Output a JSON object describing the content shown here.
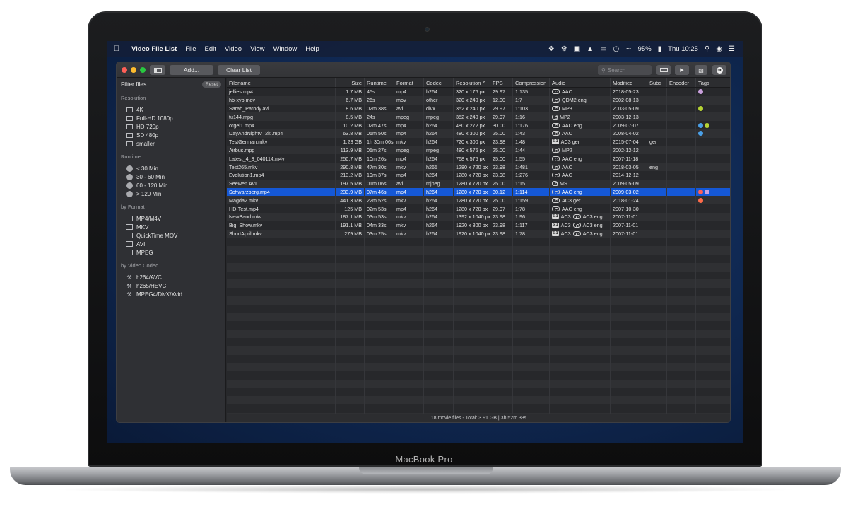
{
  "device": {
    "label": "MacBook Pro"
  },
  "menubar": {
    "app_name": "Video File List",
    "items": [
      "File",
      "Edit",
      "Video",
      "View",
      "Window",
      "Help"
    ],
    "battery": "95%",
    "clock": "Thu 10:25"
  },
  "toolbar": {
    "add_label": "Add...",
    "clear_label": "Clear List",
    "search_placeholder": "Search"
  },
  "sidebar": {
    "filter_title": "Filter files...",
    "reset_label": "Reset",
    "sections": [
      {
        "title": "Resolution",
        "icon": "film-icon",
        "items": [
          "4K",
          "Full-HD 1080p",
          "HD 720p",
          "SD 480p",
          "smaller"
        ]
      },
      {
        "title": "Runtime",
        "icon": "clock-icon",
        "items": [
          "< 30 Min",
          "30 - 60 Min",
          "60 - 120 Min",
          "> 120 Min"
        ]
      },
      {
        "title": "by Format",
        "icon": "format-icon",
        "items": [
          "MP4/M4V",
          "MKV",
          "QuickTime MOV",
          "AVI",
          "MPEG"
        ]
      },
      {
        "title": "by Video Codec",
        "icon": "wrench-icon",
        "items": [
          "h264/AVC",
          "h265/HEVC",
          "MPEG4/DivX/Xvid"
        ]
      }
    ]
  },
  "table": {
    "columns": [
      "Filename",
      "Size",
      "Runtime",
      "Format",
      "Codec",
      "Resolution",
      "FPS",
      "Compression",
      "Audio",
      "Modified",
      "Subs",
      "Encoder",
      "Tags"
    ],
    "sort_indicator": "^",
    "selected_index": 12,
    "rows": [
      {
        "file": "jellies.mp4",
        "size": "1.7 MB",
        "run": "45s",
        "fmt": "mp4",
        "codec": "h264",
        "res": "320 x 176 px",
        "fps": "29.97",
        "comp": "1:135",
        "audio": [
          {
            "k": "stereo",
            "t": "AAC"
          }
        ],
        "mod": "2018-05-23",
        "subs": "",
        "enc": "",
        "tags": [
          "#c9a0dc"
        ]
      },
      {
        "file": "hb-xyb.mov",
        "size": "6.7 MB",
        "run": "26s",
        "fmt": "mov",
        "codec": "other",
        "res": "320 x 240 px",
        "fps": "12.00",
        "comp": "1:7",
        "audio": [
          {
            "k": "stereo",
            "t": "QDM2 eng"
          }
        ],
        "mod": "2002-08-13",
        "subs": "",
        "enc": "",
        "tags": []
      },
      {
        "file": "Sarah_Parody.avi",
        "size": "8.6 MB",
        "run": "02m 38s",
        "fmt": "avi",
        "codec": "divx",
        "res": "352 x 240 px",
        "fps": "29.97",
        "comp": "1:103",
        "audio": [
          {
            "k": "stereo",
            "t": "MP3"
          }
        ],
        "mod": "2003-05-09",
        "subs": "",
        "enc": "",
        "tags": [
          "#b5d334"
        ]
      },
      {
        "file": "tu144.mpg",
        "size": "8.5 MB",
        "run": "24s",
        "fmt": "mpeg",
        "codec": "mpeg",
        "res": "352 x 240 px",
        "fps": "29.97",
        "comp": "1:16",
        "audio": [
          {
            "k": "mono",
            "t": "MP2"
          }
        ],
        "mod": "2003-12-13",
        "subs": "",
        "enc": "",
        "tags": []
      },
      {
        "file": "orgel1.mp4",
        "size": "10.2 MB",
        "run": "02m 47s",
        "fmt": "mp4",
        "codec": "h264",
        "res": "480 x 272 px",
        "fps": "30.00",
        "comp": "1:176",
        "audio": [
          {
            "k": "stereo",
            "t": "AAC eng"
          }
        ],
        "mod": "2009-07-07",
        "subs": "",
        "enc": "",
        "tags": [
          "#4aa0e8",
          "#b5d334"
        ]
      },
      {
        "file": "DayAndNightV_2kl.mp4",
        "size": "63.8 MB",
        "run": "05m 50s",
        "fmt": "mp4",
        "codec": "h264",
        "res": "480 x 300 px",
        "fps": "25.00",
        "comp": "1:43",
        "audio": [
          {
            "k": "stereo",
            "t": "AAC"
          }
        ],
        "mod": "2008-04-02",
        "subs": "",
        "enc": "",
        "tags": [
          "#4aa0e8"
        ]
      },
      {
        "file": "TestGerman.mkv",
        "size": "1.28 GB",
        "run": "1h 30m 06s",
        "fmt": "mkv",
        "codec": "h264",
        "res": "720 x 300 px",
        "fps": "23.98",
        "comp": "1:48",
        "audio": [
          {
            "k": "51",
            "t": "AC3 ger"
          }
        ],
        "mod": "2015-07-04",
        "subs": "ger",
        "enc": "",
        "tags": []
      },
      {
        "file": "Airbus.mpg",
        "size": "113.9 MB",
        "run": "05m 27s",
        "fmt": "mpeg",
        "codec": "mpeg",
        "res": "480 x 576 px",
        "fps": "25.00",
        "comp": "1:44",
        "audio": [
          {
            "k": "stereo",
            "t": "MP2"
          }
        ],
        "mod": "2002-12-12",
        "subs": "",
        "enc": "",
        "tags": []
      },
      {
        "file": "Latest_4_3_040114.m4v",
        "size": "250.7 MB",
        "run": "10m 26s",
        "fmt": "mp4",
        "codec": "h264",
        "res": "768 x 576 px",
        "fps": "25.00",
        "comp": "1:55",
        "audio": [
          {
            "k": "stereo",
            "t": "AAC eng"
          }
        ],
        "mod": "2007-11-18",
        "subs": "",
        "enc": "",
        "tags": []
      },
      {
        "file": "Test265.mkv",
        "size": "290.8 MB",
        "run": "47m 30s",
        "fmt": "mkv",
        "codec": "h265",
        "res": "1280 x 720 px",
        "fps": "23.98",
        "comp": "1:481",
        "audio": [
          {
            "k": "stereo",
            "t": "AAC"
          }
        ],
        "mod": "2018-03-05",
        "subs": "eng",
        "enc": "",
        "tags": []
      },
      {
        "file": "Evolution1.mp4",
        "size": "213.2 MB",
        "run": "19m 37s",
        "fmt": "mp4",
        "codec": "h264",
        "res": "1280 x 720 px",
        "fps": "23.98",
        "comp": "1:276",
        "audio": [
          {
            "k": "stereo",
            "t": "AAC"
          }
        ],
        "mod": "2014-12-12",
        "subs": "",
        "enc": "",
        "tags": []
      },
      {
        "file": "Seewen.AVI",
        "size": "197.5 MB",
        "run": "01m 06s",
        "fmt": "avi",
        "codec": "mjpeg",
        "res": "1280 x 720 px",
        "fps": "25.00",
        "comp": "1:15",
        "audio": [
          {
            "k": "mono",
            "t": "MS"
          }
        ],
        "mod": "2009-05-09",
        "subs": "",
        "enc": "",
        "tags": []
      },
      {
        "file": "Schwarzberg.mp4",
        "size": "233.9 MB",
        "run": "07m 46s",
        "fmt": "mp4",
        "codec": "h264",
        "res": "1280 x 720 px",
        "fps": "30.12",
        "comp": "1:114",
        "audio": [
          {
            "k": "stereo",
            "t": "AAC eng"
          }
        ],
        "mod": "2009-03-02",
        "subs": "",
        "enc": "",
        "tags": [
          "#ff5f57",
          "#c9a0dc"
        ]
      },
      {
        "file": "Magda2.mkv",
        "size": "441.3 MB",
        "run": "22m 52s",
        "fmt": "mkv",
        "codec": "h264",
        "res": "1280 x 720 px",
        "fps": "25.00",
        "comp": "1:159",
        "audio": [
          {
            "k": "stereo",
            "t": "AC3 ger"
          }
        ],
        "mod": "2018-01-24",
        "subs": "",
        "enc": "",
        "tags": [
          "#ff6b4a"
        ]
      },
      {
        "file": "HD-Test.mp4",
        "size": "125 MB",
        "run": "02m 53s",
        "fmt": "mp4",
        "codec": "h264",
        "res": "1280 x 720 px",
        "fps": "29.97",
        "comp": "1:78",
        "audio": [
          {
            "k": "stereo",
            "t": "AAC eng"
          }
        ],
        "mod": "2007-10-30",
        "subs": "",
        "enc": "",
        "tags": []
      },
      {
        "file": "NewBand.mkv",
        "size": "187.1 MB",
        "run": "03m 53s",
        "fmt": "mkv",
        "codec": "h264",
        "res": "1392 x 1040 px",
        "fps": "23.98",
        "comp": "1:96",
        "audio": [
          {
            "k": "51",
            "t": "AC3"
          },
          {
            "k": "stereo",
            "t": "AC3 eng"
          }
        ],
        "mod": "2007-11-01",
        "subs": "",
        "enc": "",
        "tags": []
      },
      {
        "file": "Big_Show.mkv",
        "size": "191.1 MB",
        "run": "04m 33s",
        "fmt": "mkv",
        "codec": "h264",
        "res": "1920 x 800 px",
        "fps": "23.98",
        "comp": "1:117",
        "audio": [
          {
            "k": "51",
            "t": "AC3"
          },
          {
            "k": "stereo",
            "t": "AC3 eng"
          }
        ],
        "mod": "2007-11-01",
        "subs": "",
        "enc": "",
        "tags": []
      },
      {
        "file": "ShortApril.mkv",
        "size": "279 MB",
        "run": "03m 25s",
        "fmt": "mkv",
        "codec": "h264",
        "res": "1920 x 1040 px",
        "fps": "23.98",
        "comp": "1:78",
        "audio": [
          {
            "k": "51",
            "t": "AC3"
          },
          {
            "k": "stereo",
            "t": "AC3 eng"
          }
        ],
        "mod": "2007-11-01",
        "subs": "",
        "enc": "",
        "tags": []
      }
    ]
  },
  "status": {
    "summary": "18 movie files - Total: 3.91 GB | 3h 52m 33s"
  }
}
